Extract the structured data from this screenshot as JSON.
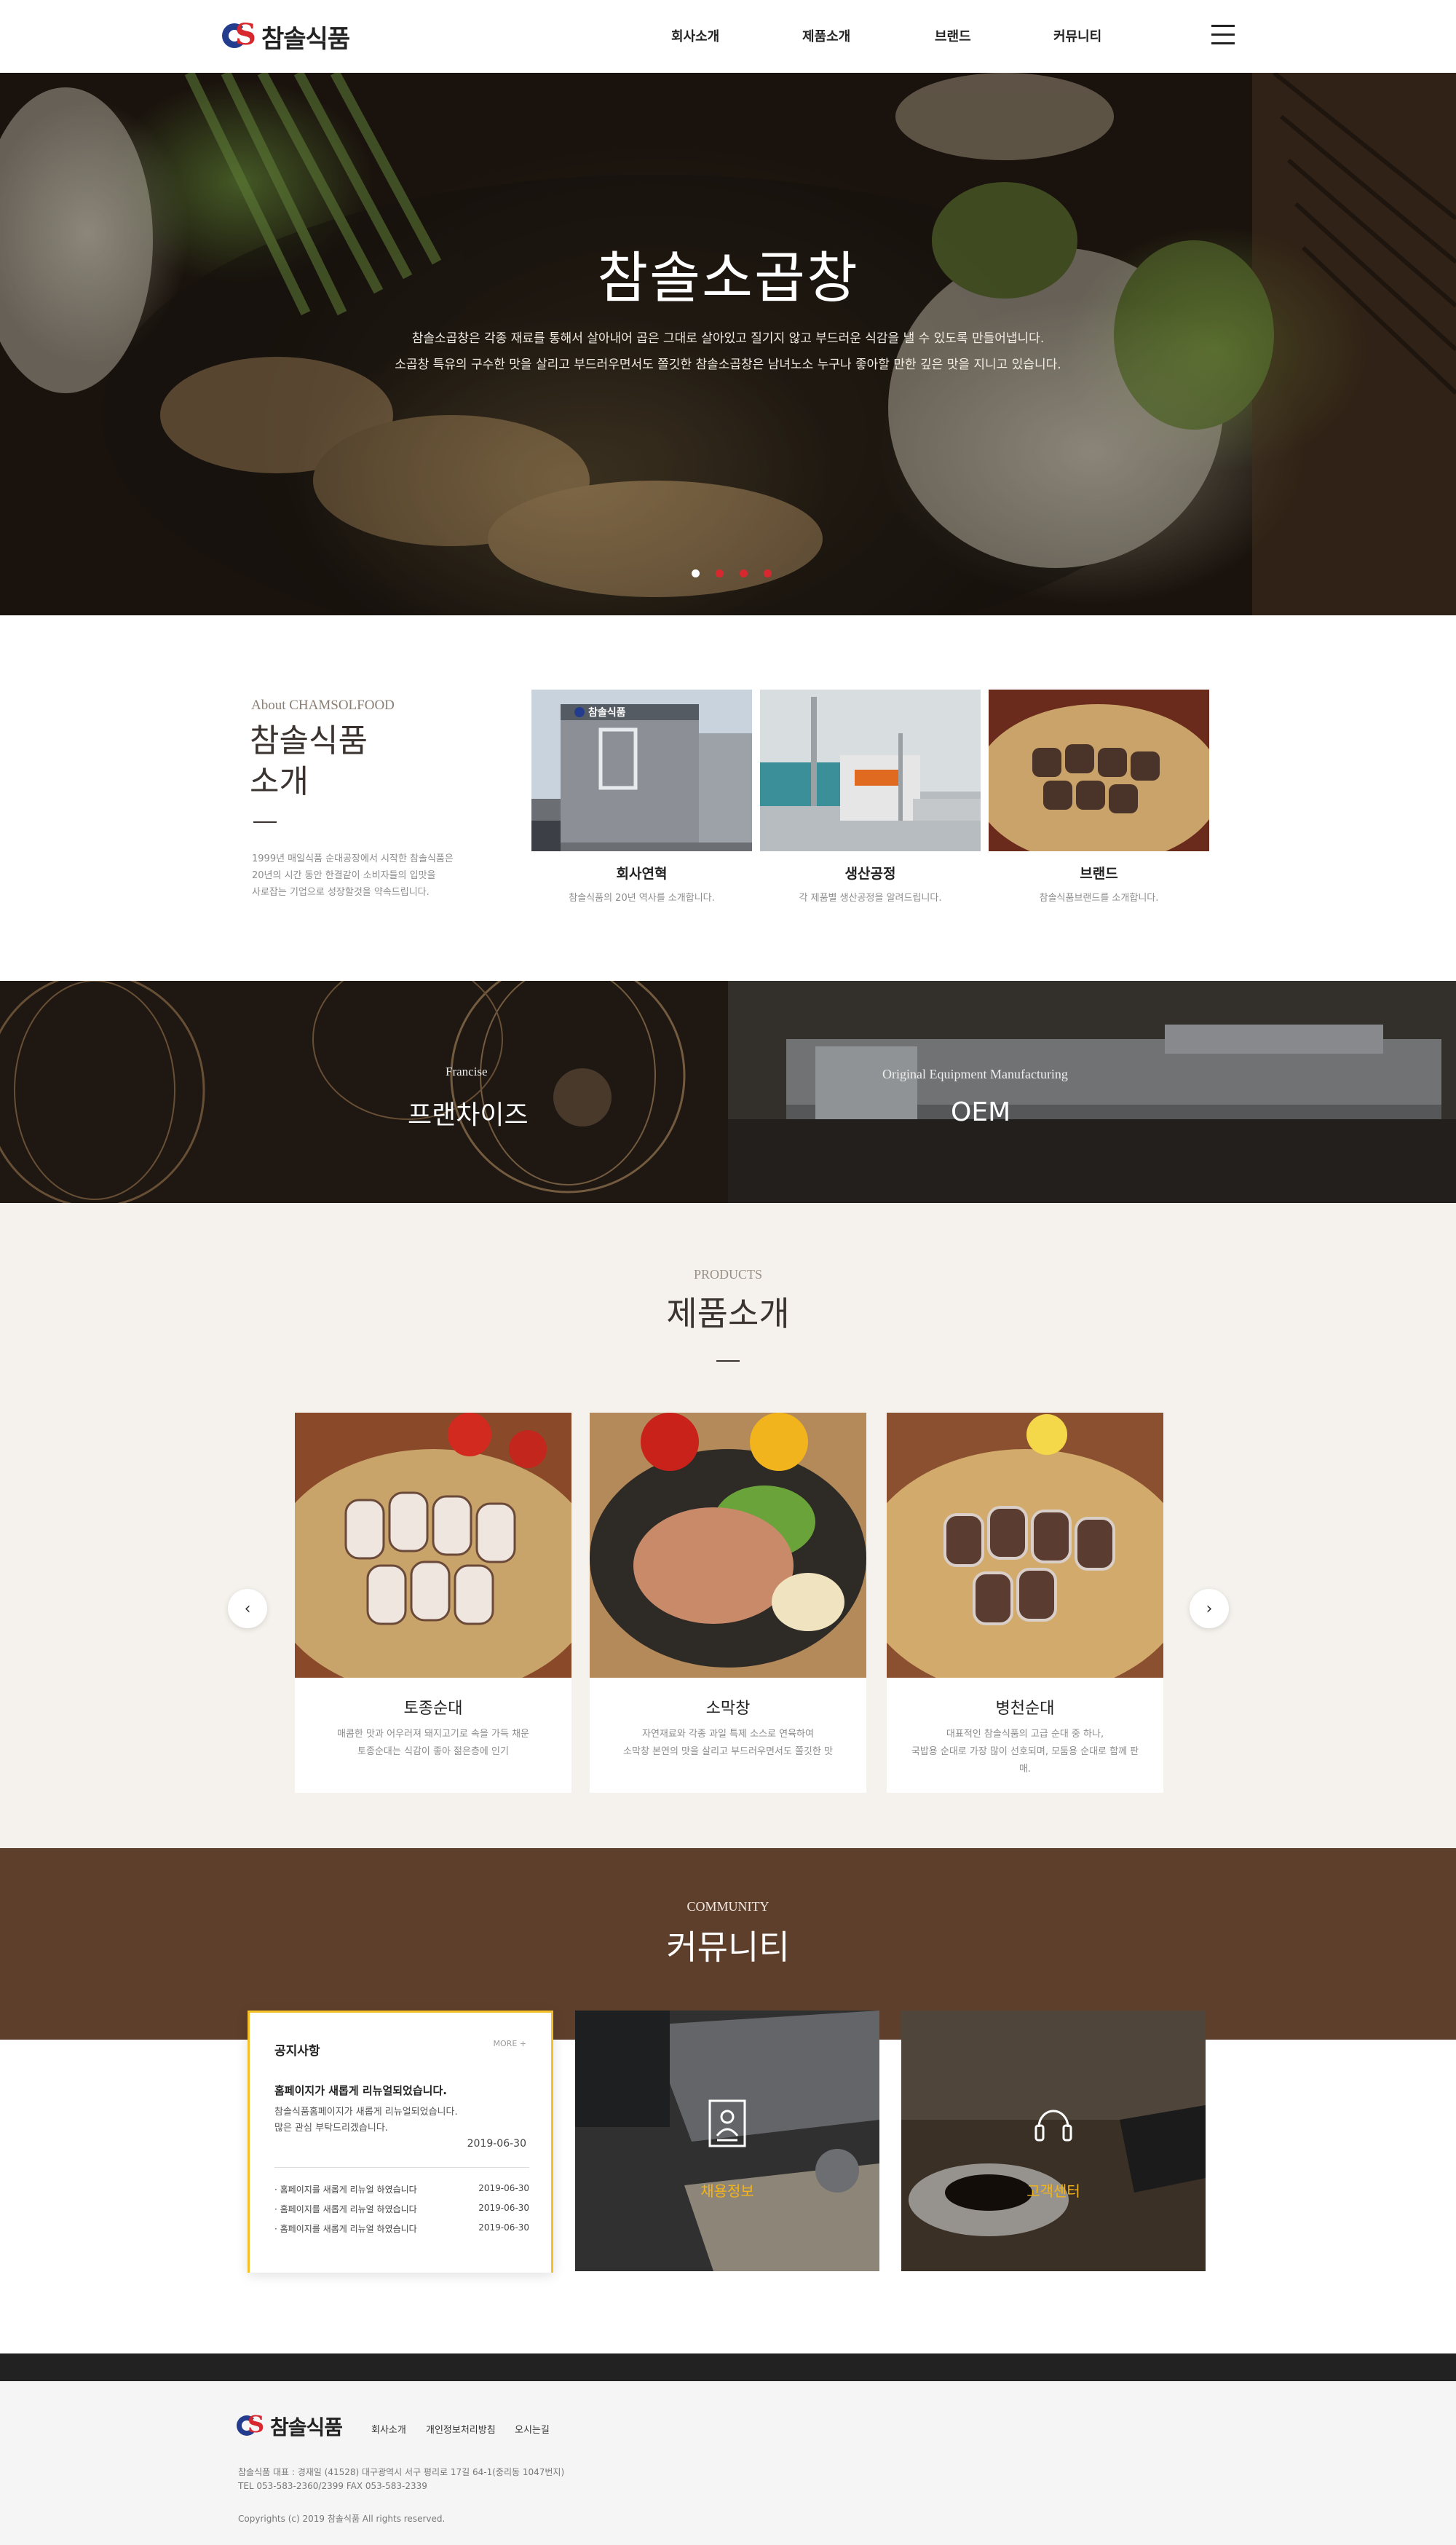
{
  "header": {
    "logo_text": "참솔식품",
    "nav": [
      "회사소개",
      "제품소개",
      "브랜드",
      "커뮤니티"
    ]
  },
  "hero": {
    "title": "참솔소곱창",
    "desc_line1": "참솔소곱창은 각종 재료를 통해서 살아내어 곱은 그대로 살아있고 질기지 않고 부드러운 식감을 낼 수 있도록 만들어냅니다.",
    "desc_line2": "소곱창 특유의 구수한 맛을 살리고 부드러우면서도 쫄깃한 참솔소곱창은 남녀노소 누구나 좋아할 만한 깊은 맛을 지니고 있습니다.",
    "dots": 4,
    "active_dot": 0,
    "colors": {
      "active_dot": "#ffffff",
      "dot": "#d7282f"
    }
  },
  "about": {
    "subtitle": "About CHAMSOLFOOD",
    "title_line1": "참솔식품",
    "title_line2": "소개",
    "desc_line1": "1999년 매일식품 순대공장에서 시작한 참솔식품은",
    "desc_line2": "20년의 시간 동안 한결같이 소비자들의 입맛을",
    "desc_line3": "사로잡는 기업으로 성장할것을 약속드립니다.",
    "cards": [
      {
        "title": "회사연혁",
        "desc": "참솔식품의 20년 역사를 소개합니다."
      },
      {
        "title": "생산공정",
        "desc": "각 제품별 생산공정을 알려드립니다."
      },
      {
        "title": "브랜드",
        "desc": "참솔식품브랜드를 소개합니다."
      }
    ],
    "building_sign": "참솔식품"
  },
  "bands": {
    "franchise_small": "Francise",
    "franchise_big": "프랜차이즈",
    "oem_small": "Original Equipment Manufacturing",
    "oem_big": "OEM"
  },
  "products": {
    "subtitle": "PRODUCTS",
    "title": "제품소개",
    "items": [
      {
        "name": "토종순대",
        "desc1": "매콤한 맛과 어우러져 돼지고기로 속을 가득 채운",
        "desc2": "토종순대는 식감이 좋아 젊은층에 인기"
      },
      {
        "name": "소막창",
        "desc1": "자연재료와 각종 과일 특제 소스로 연육하여",
        "desc2": "소막창 본연의 맛을 살리고 부드러우면서도 쫄깃한 맛"
      },
      {
        "name": "병천순대",
        "desc1": "대표적인 참솔식품의 고급 순대 중 하나,",
        "desc2": "국밥용 순대로 가장 많이 선호되며, 모둠용 순대로 함께 판매."
      }
    ],
    "prev_icon": "chevron-left-icon",
    "next_icon": "chevron-right-icon"
  },
  "community": {
    "subtitle": "COMMUNITY",
    "title": "커뮤니티",
    "notice": {
      "head": "공지사항",
      "more": "MORE +",
      "highlight_title": "홈페이지가 새롭게 리뉴얼되었습니다.",
      "highlight_text1": "참솔식품홈페이지가 새롭게 리뉴얼되었습니다.",
      "highlight_text2": "많은 관심 부탁드리겠습니다.",
      "highlight_date": "2019-06-30",
      "rows": [
        {
          "title": "홈페이지를 새롭게 리뉴얼 하였습니다",
          "date": "2019-06-30"
        },
        {
          "title": "홈페이지를 새롭게 리뉴얼 하였습니다",
          "date": "2019-06-30"
        },
        {
          "title": "홈페이지를 새롭게 리뉴얼 하였습니다",
          "date": "2019-06-30"
        }
      ]
    },
    "recruit_label": "채용정보",
    "support_label": "고객센터"
  },
  "footer": {
    "logo_text": "참솔식품",
    "links": [
      "회사소개",
      "개인정보처리방침",
      "오시는길"
    ],
    "info_line1": "참솔식품  대표 : 경재일  (41528) 대구광역시 서구 평리로 17길 64-1(중리동 1047번지)",
    "info_line2": "TEL 053-583-2360/2399  FAX 053-583-2339",
    "copyright": "Copyrights (c) 2019  참솔식품   All rights reserved."
  }
}
